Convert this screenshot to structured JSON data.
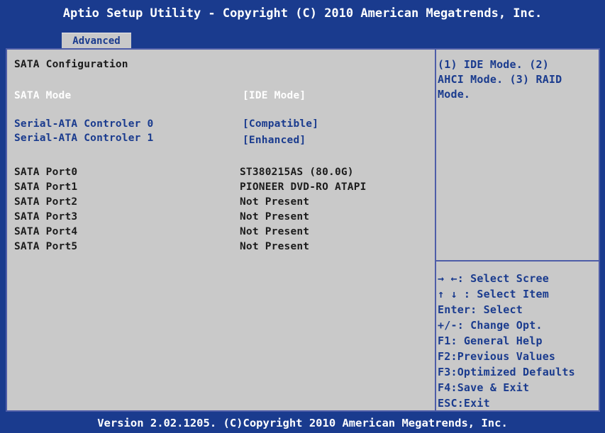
{
  "header": {
    "title": "Aptio Setup Utility - Copyright (C) 2010 American Megatrends, Inc.",
    "tab": "Advanced"
  },
  "main": {
    "section_title": "SATA Configuration",
    "sata_mode": {
      "label": "SATA Mode",
      "value": "[IDE Mode]"
    },
    "controllers": [
      {
        "label": "Serial-ATA Controler 0",
        "value": "[Compatible]"
      },
      {
        "label": "Serial-ATA Controler 1",
        "value": "[Enhanced]"
      }
    ],
    "ports": [
      {
        "label": "SATA Port0",
        "value": "ST380215AS (80.0G)"
      },
      {
        "label": "SATA Port1",
        "value": "PIONEER DVD-RO ATAPI"
      },
      {
        "label": "SATA Port2",
        "value": "Not Present"
      },
      {
        "label": "SATA Port3",
        "value": "Not Present"
      },
      {
        "label": "SATA Port4",
        "value": "Not Present"
      },
      {
        "label": "SATA Port5",
        "value": "Not Present"
      }
    ]
  },
  "help": {
    "description": [
      "(1) IDE Mode. (2)",
      "AHCI Mode. (3) RAID",
      "Mode."
    ],
    "keys": [
      "→ ←:  Select Scree",
      "↑ ↓ :  Select Item",
      "Enter: Select",
      "+/-:  Change Opt.",
      "F1: General Help",
      "F2:Previous Values",
      "F3:Optimized Defaults",
      "F4:Save & Exit",
      "ESC:Exit"
    ]
  },
  "footer": {
    "version": "Version 2.02.1205. (C)Copyright 2010 American Megatrends, Inc."
  },
  "colors": {
    "background": "#1a3b8e",
    "panel": "#c9c9c9",
    "highlight": "#ffffff",
    "option_text": "#1a3b8e"
  }
}
